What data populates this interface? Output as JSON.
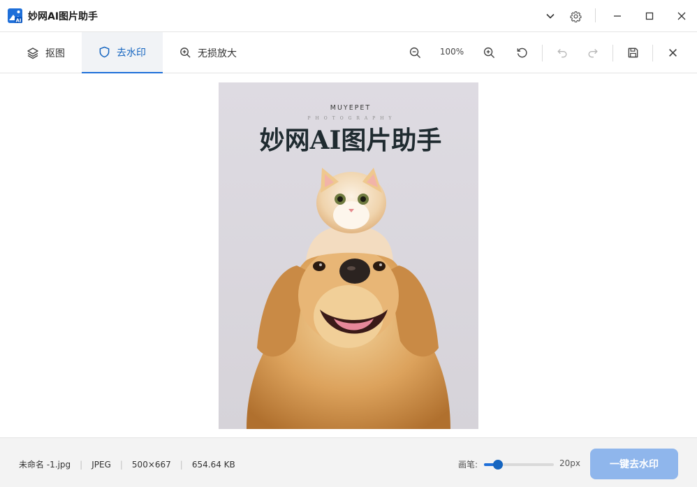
{
  "app": {
    "title": "妙网AI图片助手",
    "logo_text": "AI"
  },
  "window_controls": {
    "icons": [
      "chevron-down-icon",
      "gear-icon",
      "minimize-icon",
      "maximize-icon",
      "close-icon"
    ]
  },
  "toolbar": {
    "tabs": [
      {
        "label": "抠图",
        "icon": "layers-icon",
        "active": false
      },
      {
        "label": "去水印",
        "icon": "shield-icon",
        "active": true
      },
      {
        "label": "无损放大",
        "icon": "zoom-in-icon",
        "active": false
      }
    ],
    "zoom_level": "100%",
    "tools": [
      "zoom-out-icon",
      "zoom-in-icon",
      "reset-icon",
      "undo-icon",
      "redo-icon",
      "save-icon",
      "close-icon"
    ]
  },
  "image": {
    "brand": "MUYEPET",
    "brand_sub": "PHOTOGRAPHY",
    "watermark": "妙网AI图片助手"
  },
  "footer": {
    "file_name": "未命名 -1.jpg",
    "format": "JPEG",
    "dimensions": "500×667",
    "file_size": "654.64 KB",
    "brush_label": "画笔:",
    "brush_value": "20px",
    "brush_fraction": 0.2,
    "action_label": "一键去水印"
  },
  "colors": {
    "accent": "#1e6fd9",
    "button_disabled": "#8fb6ec"
  }
}
